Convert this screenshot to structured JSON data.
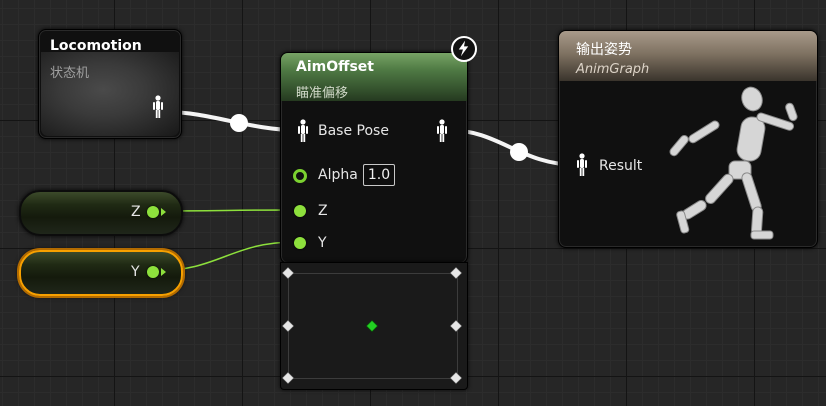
{
  "locomotion_node": {
    "title": "Locomotion",
    "subtitle": "状态机"
  },
  "aimoffset_node": {
    "title": "AimOffset",
    "subtitle": "瞄准偏移",
    "pins": {
      "base_pose": "Base Pose",
      "alpha": "Alpha",
      "alpha_value": "1.0",
      "z": "Z",
      "y": "Y"
    }
  },
  "output_node": {
    "title": "输出姿势",
    "subtitle": "AnimGraph",
    "result_pin": "Result"
  },
  "variables": {
    "z_label": "Z",
    "y_label": "Y"
  },
  "colors": {
    "background": "#262626",
    "aimoffset_header": "#4f7a44",
    "output_header": "#8c7f6e",
    "float_pin": "#8de03c",
    "selection": "#f7a000",
    "exec_wire": "#ffffff"
  },
  "icons": [
    "pose-pin-icon",
    "lightning-icon",
    "running-mannequin-icon"
  ]
}
